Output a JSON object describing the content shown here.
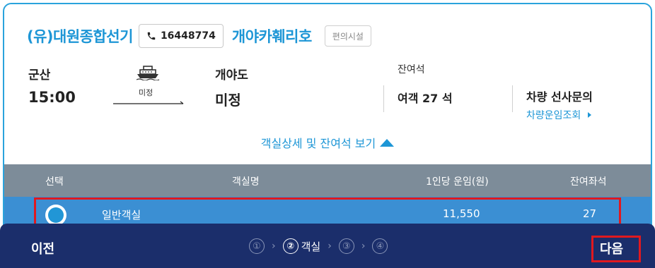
{
  "header": {
    "company": "(유)대원종합선기",
    "phone": "16448774",
    "ship_name": "개야카훼리호",
    "facility_button": "편의시설"
  },
  "route": {
    "departure_port": "군산",
    "departure_time": "15:00",
    "route_status": "미정",
    "arrival_port": "개야도",
    "arrival_status": "미정"
  },
  "seats": {
    "label": "잔여석",
    "passenger_value": "여객 27 석"
  },
  "vehicle": {
    "title": "차량 선사문의",
    "link": "차량운임조회"
  },
  "detail_toggle": "객실상세 및 잔여석 보기",
  "table": {
    "headers": {
      "select": "선택",
      "name": "객실명",
      "fare": "1인당 운임(원)",
      "remaining": "잔여좌석"
    },
    "rows": [
      {
        "name": "일반객실",
        "fare": "11,550",
        "remaining": "27",
        "selected": true
      }
    ]
  },
  "footer": {
    "prev": "이전",
    "next": "다음",
    "steps": [
      {
        "number": "①",
        "label": "",
        "active": false
      },
      {
        "number": "②",
        "label": "객실",
        "active": true
      },
      {
        "number": "③",
        "label": "",
        "active": false
      },
      {
        "number": "④",
        "label": "",
        "active": false
      }
    ]
  },
  "colors": {
    "accent": "#1d96d6",
    "table_header": "#7d8c99",
    "selected_row": "#3b8fd3",
    "footer": "#1b2e6b",
    "highlight": "#e0191f"
  }
}
